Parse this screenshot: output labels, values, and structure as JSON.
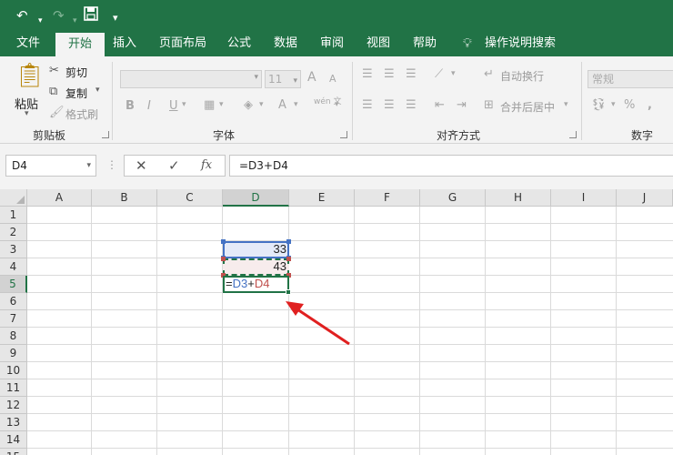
{
  "qat": {
    "undo": "↶",
    "redo": "↷",
    "save": "💾",
    "customize": "▾"
  },
  "tabs": [
    "文件",
    "开始",
    "插入",
    "页面布局",
    "公式",
    "数据",
    "审阅",
    "视图",
    "帮助"
  ],
  "tell_me": "操作说明搜索",
  "ribbon": {
    "clipboard": {
      "paste": "粘贴",
      "cut": "剪切",
      "copy": "复制",
      "format_painter": "格式刷",
      "group": "剪贴板"
    },
    "font": {
      "name": "",
      "size": "11",
      "bold": "B",
      "italic": "I",
      "underline": "U",
      "group": "字体",
      "grow": "A",
      "shrink": "A",
      "wen": "wén 文"
    },
    "alignment": {
      "wrap": "自动换行",
      "merge": "合并后居中",
      "group": "对齐方式"
    },
    "number": {
      "format": "常规",
      "percent": "%",
      "comma": ",",
      "group": "数字"
    }
  },
  "formula_bar": {
    "name_box": "D4",
    "formula": "=D3+D4",
    "cancel": "✕",
    "enter": "✓",
    "fx": "fx",
    "dots": "⋮"
  },
  "grid": {
    "columns": [
      "A",
      "B",
      "C",
      "D",
      "E",
      "F",
      "G",
      "H",
      "I",
      "J"
    ],
    "rows": [
      "1",
      "2",
      "3",
      "4",
      "5",
      "6",
      "7",
      "8",
      "9",
      "10",
      "11",
      "12",
      "13",
      "14",
      "15"
    ],
    "d3_value": "33",
    "d4_value": "43",
    "d5_formula": {
      "eq": "=",
      "ref1": "D3",
      "op": "+",
      "ref2": "D4"
    }
  },
  "colors": {
    "excel_green": "#217346",
    "ref_blue": "#4472c4",
    "ref_red": "#c0504d",
    "arrow_red": "#e02020"
  }
}
